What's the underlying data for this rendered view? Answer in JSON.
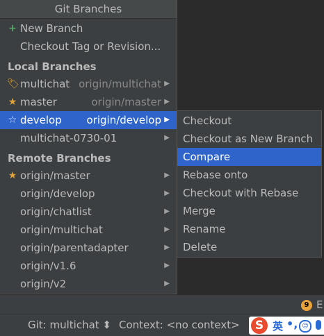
{
  "popup": {
    "title": "Git Branches",
    "actions": [
      {
        "icon": "plus-icon",
        "glyph": "+",
        "label": "New Branch"
      },
      {
        "icon": "",
        "glyph": "",
        "label": "Checkout Tag or Revision..."
      }
    ],
    "local_header": "Local Branches",
    "local": [
      {
        "icon": "tag-icon",
        "glyph": "🏷",
        "label": "multichat",
        "tracking": "origin/multichat"
      },
      {
        "icon": "star-icon",
        "glyph": "★",
        "label": "master",
        "tracking": "origin/master"
      },
      {
        "icon": "star-outline-icon",
        "glyph": "☆",
        "label": "develop",
        "tracking": "origin/develop"
      },
      {
        "icon": "",
        "glyph": "",
        "label": "multichat-0730-01",
        "tracking": ""
      }
    ],
    "remote_header": "Remote Branches",
    "remote": [
      {
        "icon": "star-icon",
        "glyph": "★",
        "label": "origin/master"
      },
      {
        "label": "origin/develop"
      },
      {
        "label": "origin/chatlist"
      },
      {
        "label": "origin/multichat"
      },
      {
        "label": "origin/parentadapter"
      },
      {
        "label": "origin/v1.6"
      },
      {
        "label": "origin/v2"
      }
    ],
    "arrow_glyph": "▶"
  },
  "submenu": {
    "items": [
      "Checkout",
      "Checkout as New Branch",
      "Compare",
      "Rebase onto",
      "Checkout with Rebase",
      "Merge",
      "Rename",
      "Delete"
    ],
    "selected": "Compare"
  },
  "status": {
    "event_count": "9",
    "event_text": "E",
    "git_branch": "Git: multichat ⬍",
    "context": "Context: <no context>",
    "ime_logo": "S",
    "ime_lang": "英",
    "ime_punct": "•,",
    "ime_emoji": "☺"
  },
  "colors": {
    "selection": "#2f65ca",
    "background": "#3c3f41",
    "accent_star": "#e0a33b",
    "accent_green": "#59a869"
  }
}
